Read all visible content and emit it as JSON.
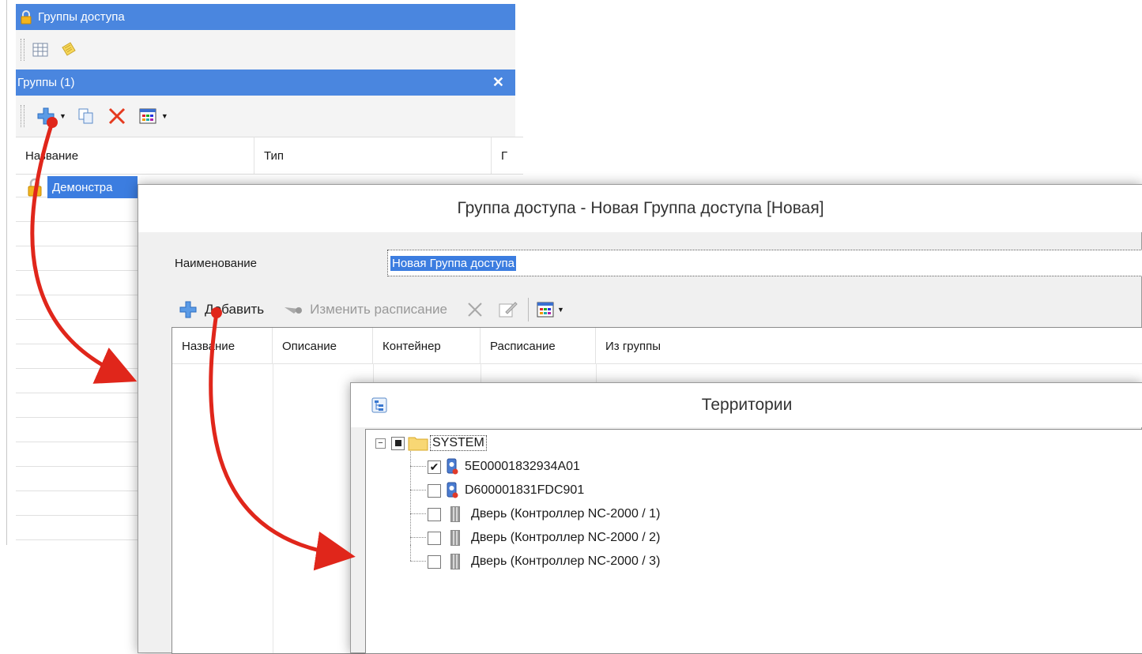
{
  "window_main": {
    "title": "Группы доступа",
    "panel_title": "Группы (1)",
    "close_glyph": "✕",
    "columns": [
      "Название",
      "Тип",
      "Г"
    ],
    "selected_row": "Демонстра"
  },
  "dialog_group": {
    "title": "Группа доступа - Новая Группа доступа [Новая]",
    "name_label": "Наименование",
    "name_value": "Новая Группа доступа",
    "toolbar": {
      "add_label": "Добавить",
      "edit_schedule_label": "Изменить расписание"
    },
    "columns": [
      "Название",
      "Описание",
      "Контейнер",
      "Расписание",
      "Из группы"
    ]
  },
  "dialog_territories": {
    "title": "Территории",
    "root": {
      "label": "SYSTEM",
      "expanded": true,
      "check_state": "partial"
    },
    "items": [
      {
        "label": "5E00001832934A01",
        "checked": true,
        "icon": "reader-icon"
      },
      {
        "label": "D600001831FDC901",
        "checked": false,
        "icon": "reader-icon"
      },
      {
        "label": "Дверь (Контроллер NC-2000 / 1)",
        "checked": false,
        "icon": "door-icon"
      },
      {
        "label": "Дверь (Контроллер NC-2000 / 2)",
        "checked": false,
        "icon": "door-icon"
      },
      {
        "label": "Дверь (Контроллер NC-2000 / 3)",
        "checked": false,
        "icon": "door-icon"
      }
    ]
  },
  "colors": {
    "titlebar": "#4a86df",
    "selection": "#3c7de0",
    "arrow": "#e0261b"
  }
}
